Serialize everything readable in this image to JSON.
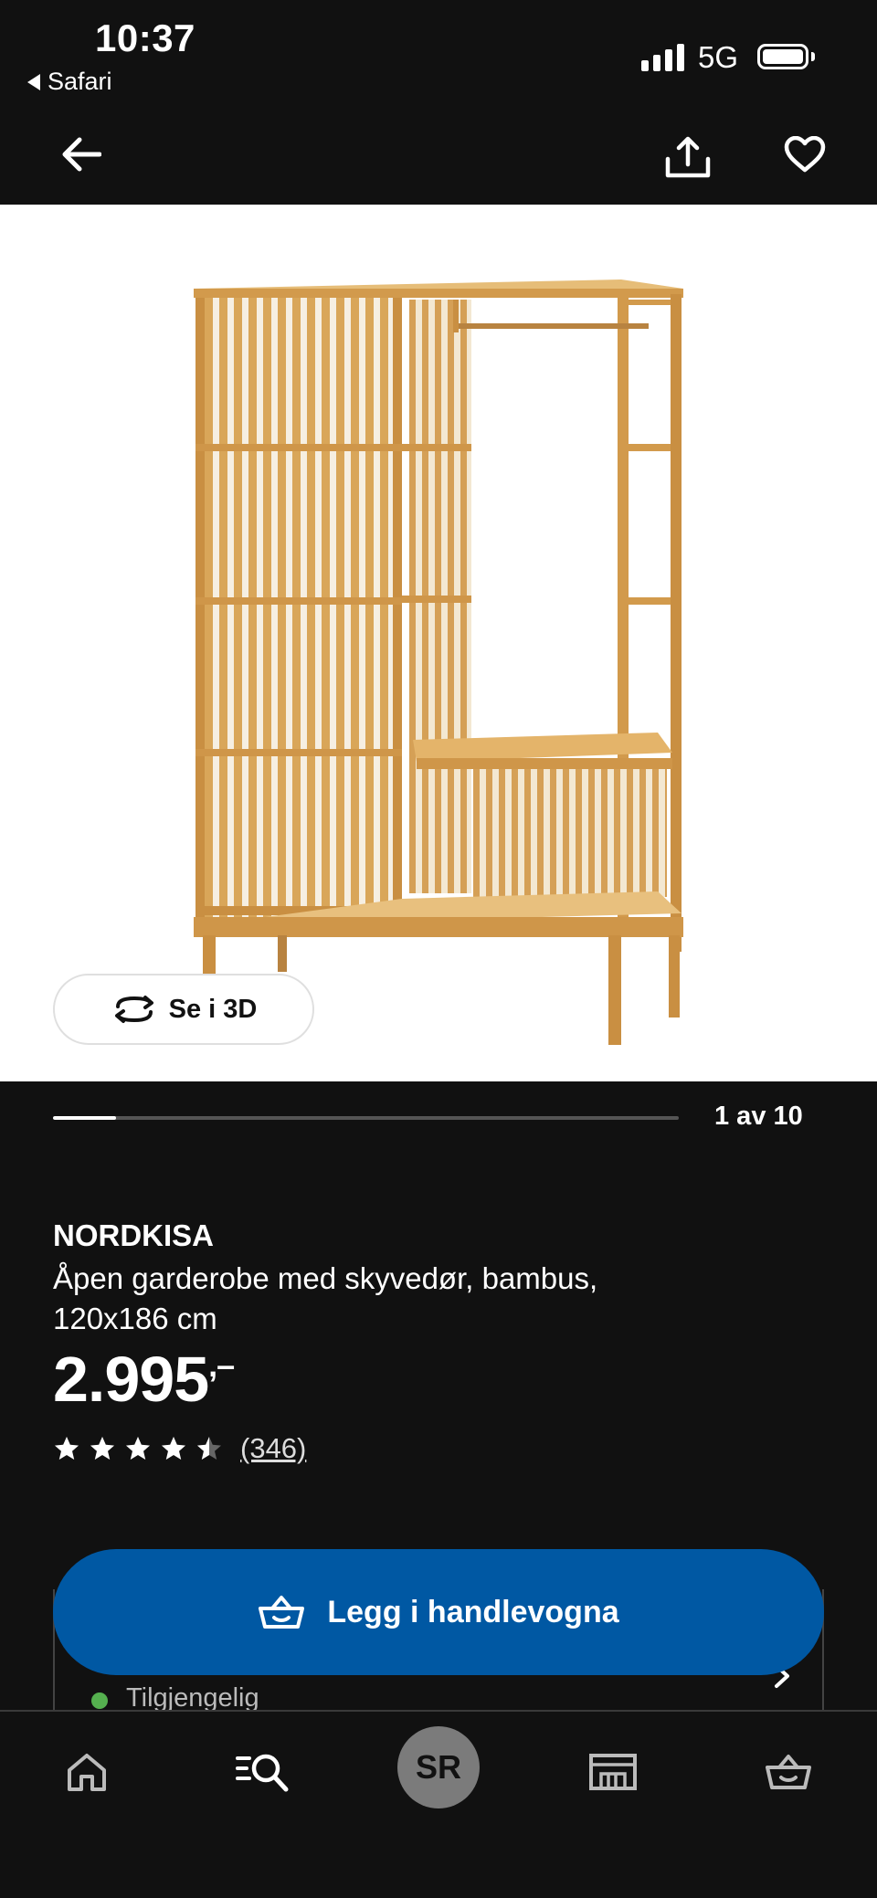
{
  "status_bar": {
    "time": "10:37",
    "back_app": "Safari",
    "network": "5G"
  },
  "nav": {
    "back_icon": "arrow-left-icon",
    "share_icon": "share-icon",
    "favourite_icon": "heart-icon"
  },
  "gallery": {
    "see_3d_label": "Se i 3D",
    "counter": "1 av 10",
    "current": 1,
    "total": 10
  },
  "product": {
    "brand": "NORDKISA",
    "description": "Åpen garderobe med skyvedør, bambus, 120x186 cm",
    "price": "2.995",
    "price_suffix": ",–",
    "rating": 4.5,
    "rating_max": 5,
    "reviews": "(346)"
  },
  "cart": {
    "label": "Legg i handlevogna",
    "icon": "basket-icon"
  },
  "availability": {
    "label": "Tilgjengelig",
    "status_color": "#55b04f"
  },
  "tabbar": {
    "items": [
      "home-icon",
      "search-icon",
      "profile",
      "store-icon",
      "cart-icon"
    ],
    "avatar_initials": "SR"
  },
  "colors": {
    "background": "#111111",
    "accent": "#0058a3",
    "text": "#ffffff"
  }
}
